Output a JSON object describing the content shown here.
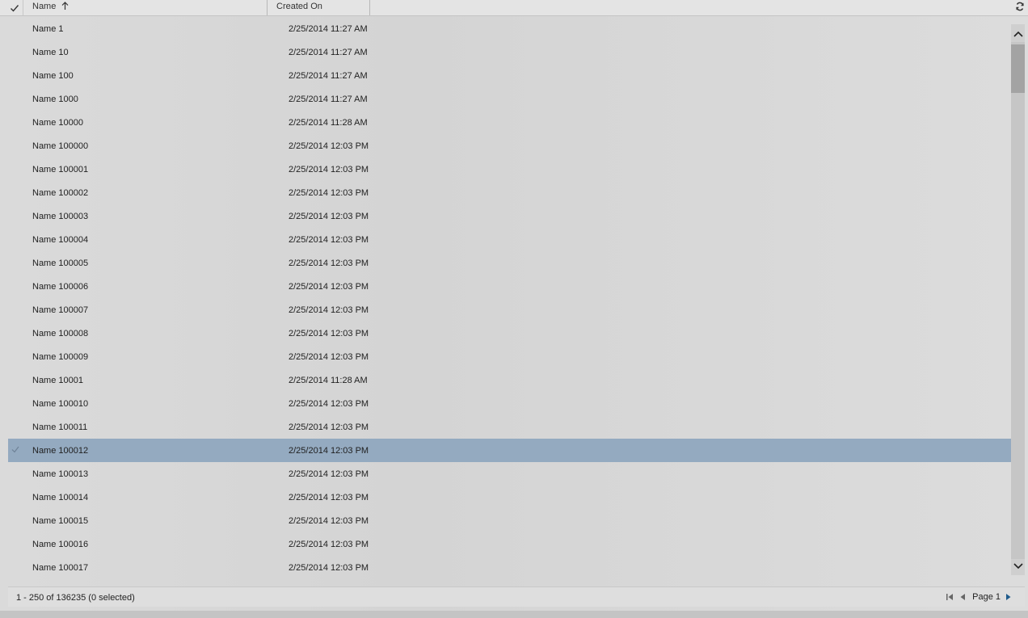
{
  "header": {
    "name_label": "Name",
    "created_label": "Created On"
  },
  "rows": [
    {
      "name": "Name 1",
      "created": "2/25/2014 11:27 AM"
    },
    {
      "name": "Name 10",
      "created": "2/25/2014 11:27 AM"
    },
    {
      "name": "Name 100",
      "created": "2/25/2014 11:27 AM"
    },
    {
      "name": "Name 1000",
      "created": "2/25/2014 11:27 AM"
    },
    {
      "name": "Name 10000",
      "created": "2/25/2014 11:28 AM"
    },
    {
      "name": "Name 100000",
      "created": "2/25/2014 12:03 PM"
    },
    {
      "name": "Name 100001",
      "created": "2/25/2014 12:03 PM"
    },
    {
      "name": "Name 100002",
      "created": "2/25/2014 12:03 PM"
    },
    {
      "name": "Name 100003",
      "created": "2/25/2014 12:03 PM"
    },
    {
      "name": "Name 100004",
      "created": "2/25/2014 12:03 PM"
    },
    {
      "name": "Name 100005",
      "created": "2/25/2014 12:03 PM"
    },
    {
      "name": "Name 100006",
      "created": "2/25/2014 12:03 PM"
    },
    {
      "name": "Name 100007",
      "created": "2/25/2014 12:03 PM"
    },
    {
      "name": "Name 100008",
      "created": "2/25/2014 12:03 PM"
    },
    {
      "name": "Name 100009",
      "created": "2/25/2014 12:03 PM"
    },
    {
      "name": "Name 10001",
      "created": "2/25/2014 11:28 AM"
    },
    {
      "name": "Name 100010",
      "created": "2/25/2014 12:03 PM"
    },
    {
      "name": "Name 100011",
      "created": "2/25/2014 12:03 PM"
    },
    {
      "name": "Name 100012",
      "created": "2/25/2014 12:03 PM",
      "selected": true
    },
    {
      "name": "Name 100013",
      "created": "2/25/2014 12:03 PM"
    },
    {
      "name": "Name 100014",
      "created": "2/25/2014 12:03 PM"
    },
    {
      "name": "Name 100015",
      "created": "2/25/2014 12:03 PM"
    },
    {
      "name": "Name 100016",
      "created": "2/25/2014 12:03 PM"
    },
    {
      "name": "Name 100017",
      "created": "2/25/2014 12:03 PM"
    }
  ],
  "footer": {
    "summary": "1 - 250 of 136235 (0 selected)",
    "page_label": "Page 1"
  },
  "icons": {
    "select_all": "checkmark-icon",
    "sort": "sort-ascending-icon",
    "refresh": "refresh-icon",
    "scroll_up": "chevron-up-icon",
    "scroll_down": "chevron-down-icon",
    "first_page": "first-page-icon",
    "prev_page": "prev-page-icon",
    "next_page": "next-page-icon"
  },
  "colors": {
    "selected_row": "#94aac0",
    "next_page_accent": "#1f5b8c"
  }
}
